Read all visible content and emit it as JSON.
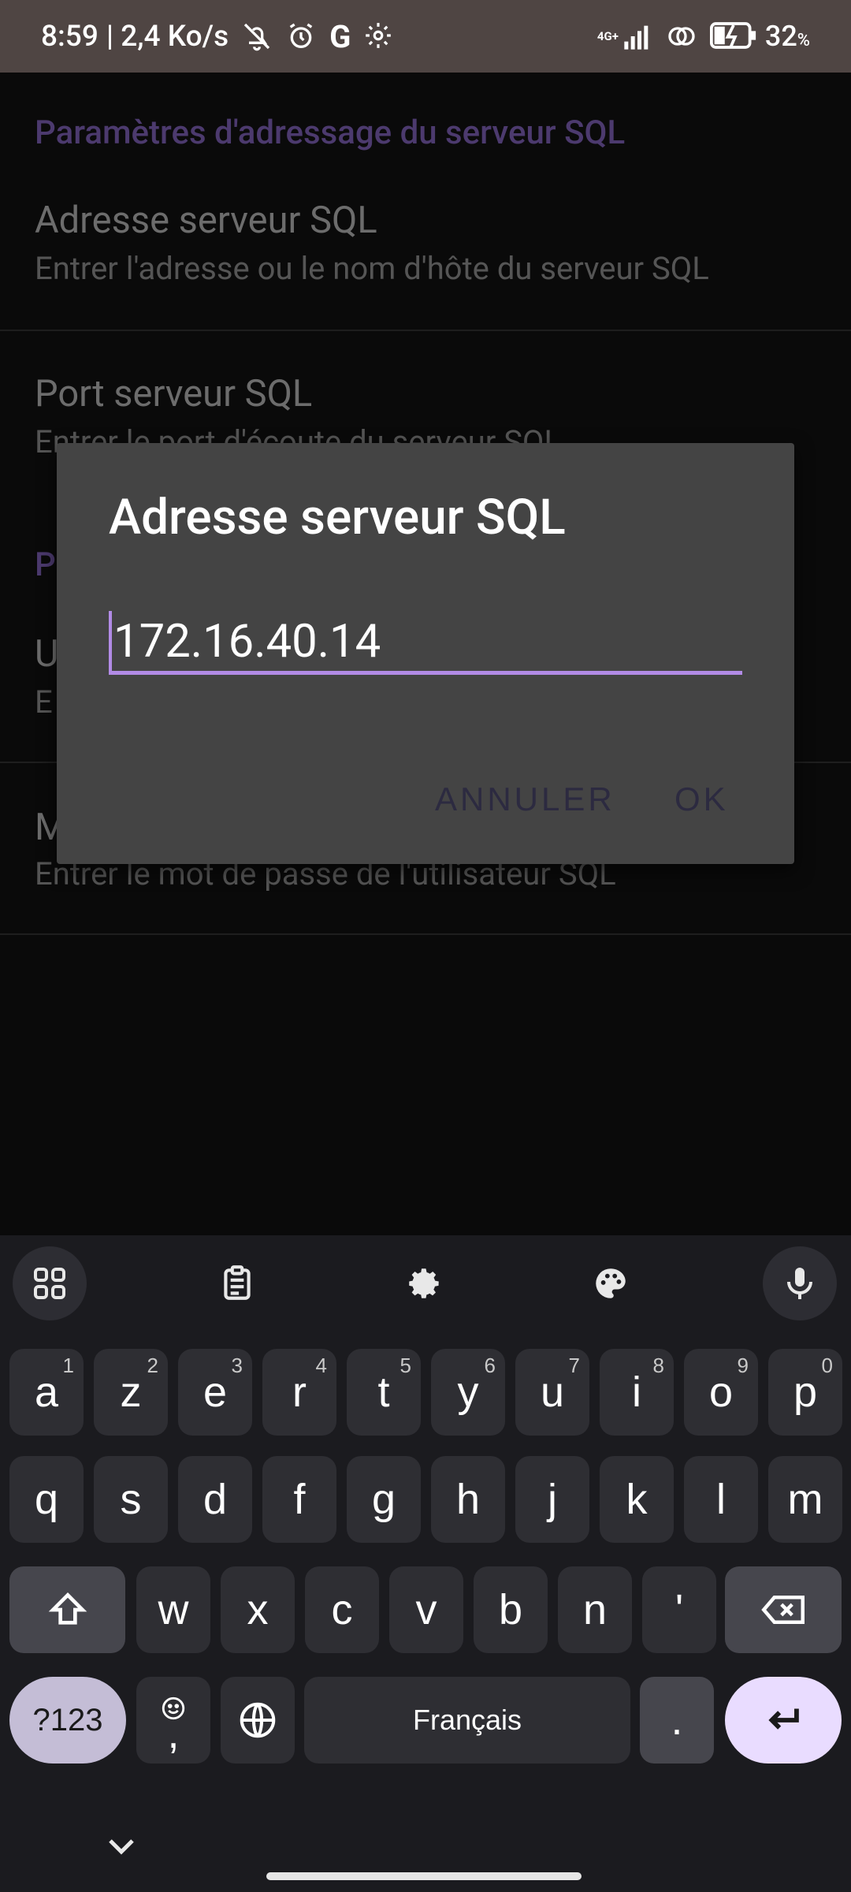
{
  "status_bar": {
    "time": "8:59",
    "speed": "| 2,4 Ko/s",
    "network": "4G+",
    "battery_pct": "32",
    "battery_unit": "%",
    "icons": [
      "bell-off-icon",
      "alarm-icon",
      "google-icon",
      "settings-icon",
      "signal-icon",
      "hotspot-icon",
      "battery-charging-icon"
    ]
  },
  "settings": {
    "category1": "Paramètres d'adressage du serveur SQL",
    "item1_title": "Adresse serveur SQL",
    "item1_sub": "Entrer l'adresse ou le nom d'hôte du serveur SQL",
    "item2_title": "Port serveur SQL",
    "item2_sub": "Entrer le port d'écoute du serveur SQL",
    "category2_partial": "P",
    "item3_title_partial": "U",
    "item3_sub_partial": "E",
    "item4_title_partial": "M",
    "item4_sub": "Entrer le mot de passe de l'utilisateur SQL"
  },
  "dialog": {
    "title": "Adresse serveur SQL",
    "input_value": "172.16.40.14",
    "cancel_label": "ANNULER",
    "ok_label": "OK"
  },
  "keyboard": {
    "toolbar": [
      "apps-grid-icon",
      "clipboard-icon",
      "settings-icon",
      "palette-icon",
      "microphone-icon"
    ],
    "row1": [
      {
        "k": "a",
        "s": "1"
      },
      {
        "k": "z",
        "s": "2"
      },
      {
        "k": "e",
        "s": "3"
      },
      {
        "k": "r",
        "s": "4"
      },
      {
        "k": "t",
        "s": "5"
      },
      {
        "k": "y",
        "s": "6"
      },
      {
        "k": "u",
        "s": "7"
      },
      {
        "k": "i",
        "s": "8"
      },
      {
        "k": "o",
        "s": "9"
      },
      {
        "k": "p",
        "s": "0"
      }
    ],
    "row2": [
      "q",
      "s",
      "d",
      "f",
      "g",
      "h",
      "j",
      "k",
      "l",
      "m"
    ],
    "row3": [
      "w",
      "x",
      "c",
      "v",
      "b",
      "n",
      "'"
    ],
    "sym_label": "?123",
    "comma_label": ",",
    "space_label": "Français",
    "period_label": ".",
    "accent_color": "#b28be6"
  }
}
